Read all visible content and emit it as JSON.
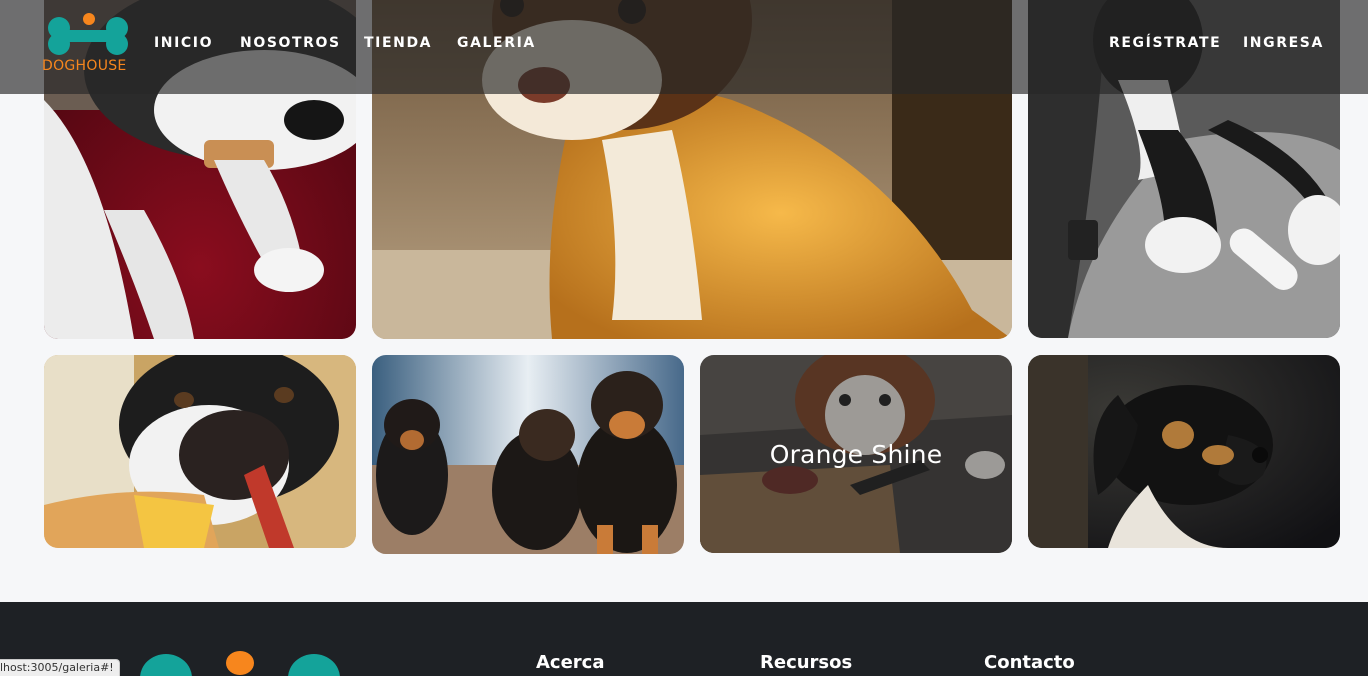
{
  "brand": {
    "name": "DOGHOUSE",
    "colors": {
      "teal": "#14a39a",
      "orange": "#f7861d"
    }
  },
  "nav": {
    "links": [
      {
        "label": "INICIO"
      },
      {
        "label": "NOSOTROS"
      },
      {
        "label": "TIENDA"
      },
      {
        "label": "GALERIA"
      }
    ],
    "register_label": "REGÍSTRATE",
    "login_label": "INGRESA"
  },
  "gallery": {
    "photos": [
      {
        "subject": "husky-with-treat"
      },
      {
        "subject": "puppy-on-stairs"
      },
      {
        "subject": "boxer-with-bone"
      },
      {
        "subject": "dog-nose-closeup"
      },
      {
        "subject": "rottweiler-puppies"
      },
      {
        "subject": "dog-at-kitchen-counter",
        "hover_label": "Orange Shine"
      },
      {
        "subject": "dog-profile-dark"
      }
    ]
  },
  "footer": {
    "headings": [
      "Acerca",
      "Recursos",
      "Contacto"
    ]
  },
  "status_bar": {
    "url": "lhost:3005/galeria#!"
  }
}
